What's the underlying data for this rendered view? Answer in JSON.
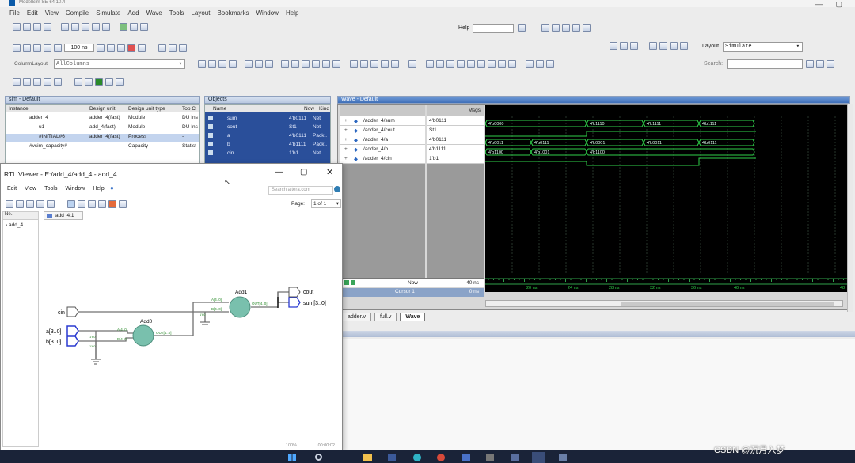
{
  "app": {
    "title": "ModelSim SE-64 10.4",
    "brand_color": "#0b5aa8"
  },
  "menu": [
    "File",
    "Edit",
    "View",
    "Compile",
    "Simulate",
    "Add",
    "Wave",
    "Tools",
    "Layout",
    "Bookmarks",
    "Window",
    "Help"
  ],
  "toolbar": {
    "help_label": "Help",
    "layout_label": "Layout",
    "layout_value": "Simulate",
    "time_value": "100 ns",
    "column_layout_label": "ColumnLayout",
    "column_layout_value": "AllColumns",
    "search_label": "Search:"
  },
  "sim": {
    "title": "sim - Default",
    "headers": [
      "Instance",
      "Design unit",
      "Design unit type",
      "Top C"
    ],
    "rows": [
      {
        "name": "adder_4",
        "unit": "adder_4(fast)",
        "type": "Module",
        "top": "DU Ins"
      },
      {
        "name": "u1",
        "unit": "add_4(fast)",
        "type": "Module",
        "top": "DU Ins"
      },
      {
        "name": "#INITIAL#6",
        "unit": "adder_4(fast)",
        "type": "Process",
        "top": "-"
      },
      {
        "name": "#vsim_capacity#",
        "unit": "",
        "type": "Capacity",
        "top": "Statist"
      }
    ]
  },
  "objects": {
    "title": "Objects",
    "headers": [
      "Name",
      "Now",
      "Kind"
    ],
    "rows": [
      {
        "name": "sum",
        "now": "4'b0111",
        "kind": "Net"
      },
      {
        "name": "cout",
        "now": "St1",
        "kind": "Net"
      },
      {
        "name": "a",
        "now": "4'b0111",
        "kind": "Pack.."
      },
      {
        "name": "b",
        "now": "4'b1111",
        "kind": "Pack.."
      },
      {
        "name": "cin",
        "now": "1'b1",
        "kind": "Net"
      }
    ]
  },
  "wave": {
    "title": "Wave - Default",
    "msgs_label": "Msgs",
    "signals": [
      {
        "name": "/adder_4/sum",
        "value": "4'b0111"
      },
      {
        "name": "/adder_4/cout",
        "value": "St1"
      },
      {
        "name": "/adder_4/a",
        "value": "4'b0111"
      },
      {
        "name": "/adder_4/b",
        "value": "4'b1111"
      },
      {
        "name": "/adder_4/cin",
        "value": "1'b1"
      }
    ],
    "now_label": "Now",
    "now_value": "40 ns",
    "cursor_label": "Cursor 1",
    "cursor_value": "0 ns",
    "ticks": [
      "20 ns",
      "24 ns",
      "28 ns",
      "32 ns",
      "36 ns",
      "40 ns",
      "48"
    ],
    "sum_values": [
      "4'b0000",
      "4'b1110",
      "4'b1111",
      "4'b1111"
    ],
    "a_values": [
      "4'b0011",
      "4'b0111",
      "4'b0001",
      "4'b0011",
      "4'b0111"
    ],
    "b_values": [
      "4'b1100",
      "4'b1001",
      "4'b1100"
    ],
    "tabs": [
      "adder.v",
      "full.v",
      "Wave"
    ]
  },
  "rtl": {
    "title": "RTL Viewer - E:/add_4/add_4 - add_4",
    "menu": [
      "Edit",
      "View",
      "Tools",
      "Window",
      "Help"
    ],
    "search_placeholder": "Search altera.com",
    "page_label": "Page:",
    "page_value": "1 of 1",
    "tab": "add_4:1",
    "tree_header": "Ne..",
    "tree_item": "add_4",
    "zoom": "100%",
    "coords": "00:00:02",
    "labels": {
      "cin": "cin",
      "a": "a[3..0]",
      "b": "b[3..0]",
      "cout": "cout",
      "sum": "sum[3..0]",
      "add0": "Add0",
      "add1": "Add1",
      "ina0": "A[4..0]",
      "inb0": "B[4..0]",
      "out0": "OUT[4..0]",
      "ina1": "A[4..0]",
      "inb1": "B[4..0]",
      "out1": "OUT[4..0]",
      "c0": "1'b0",
      "c1": "1'b0",
      "c2": "1'b0"
    }
  },
  "watermark": "CSDN @沉月入梦"
}
